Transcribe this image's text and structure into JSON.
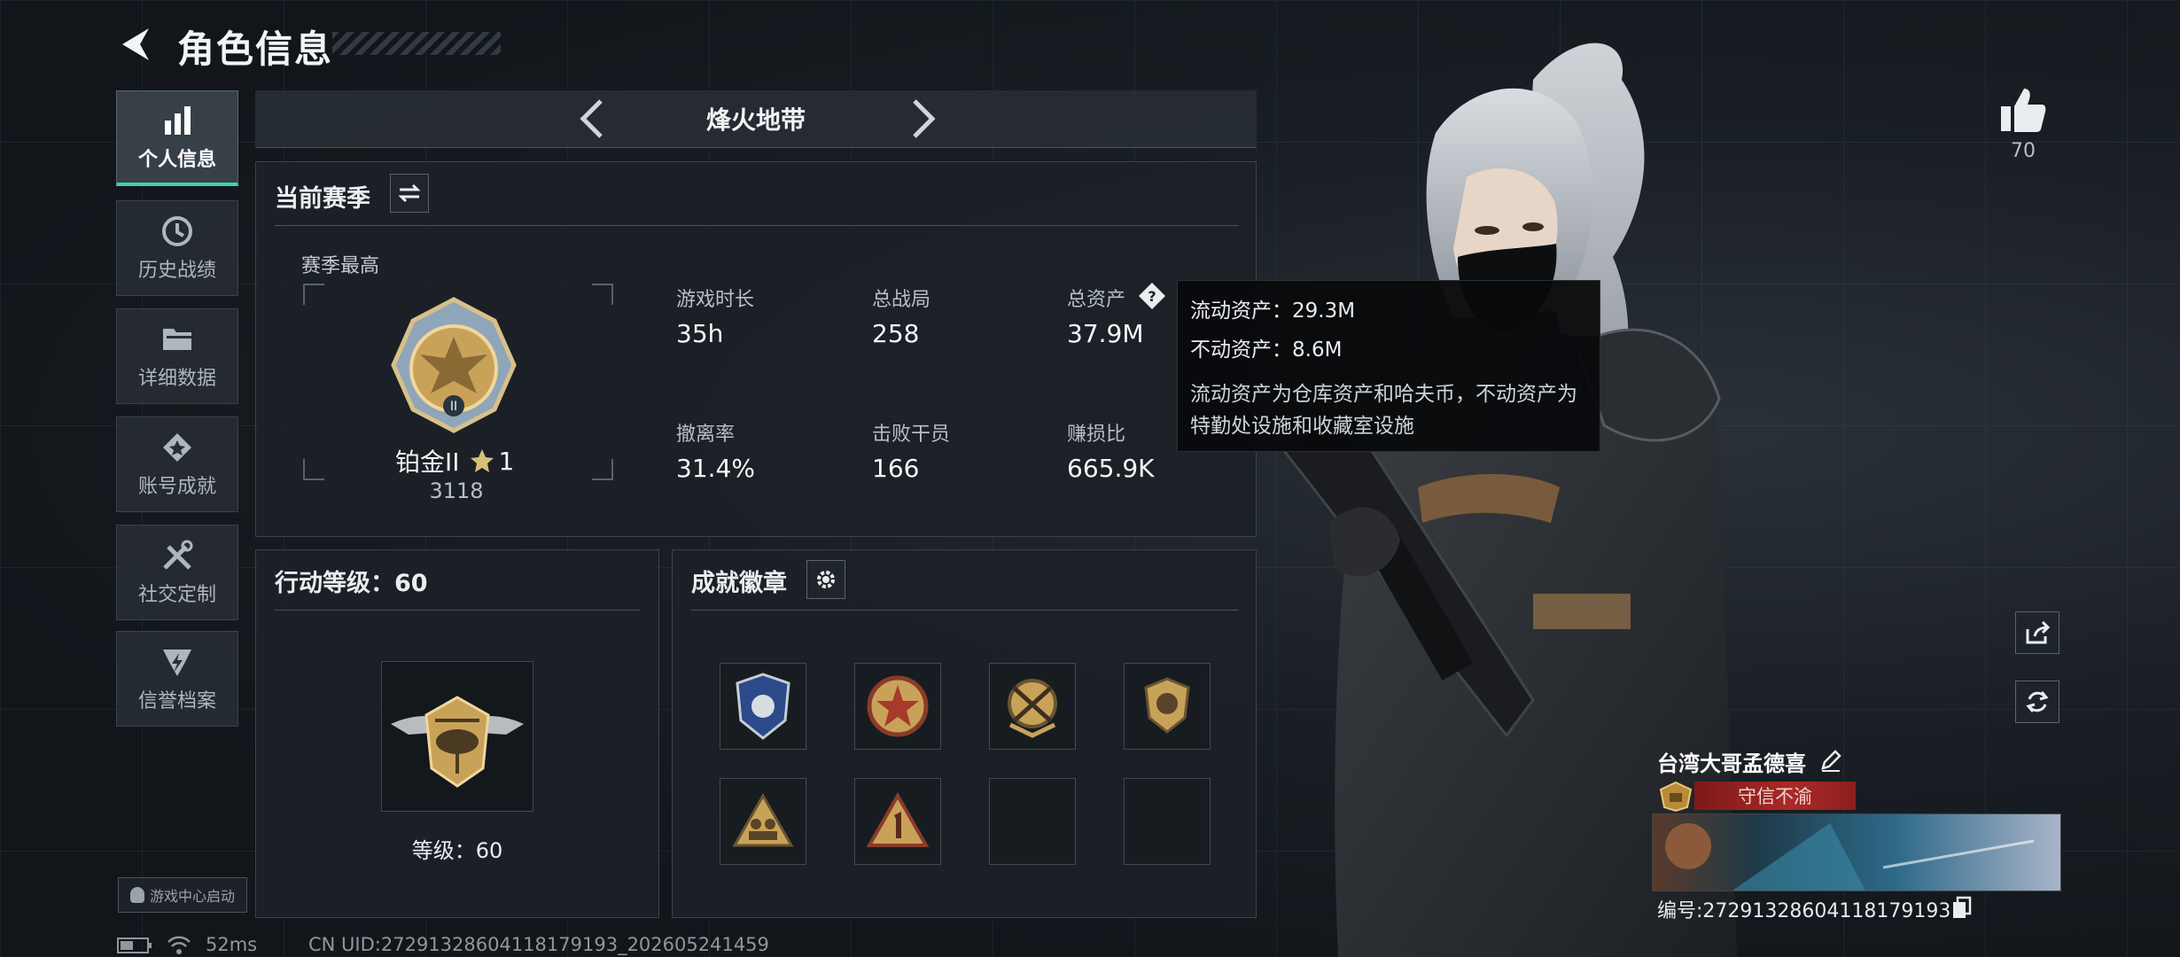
{
  "header": {
    "title": "角色信息"
  },
  "sidebar": {
    "items": [
      {
        "label": "个人信息",
        "icon": "bar-chart-icon",
        "active": true
      },
      {
        "label": "历史战绩",
        "icon": "history-icon"
      },
      {
        "label": "详细数据",
        "icon": "folder-icon"
      },
      {
        "label": "账号成就",
        "icon": "achievement-icon"
      },
      {
        "label": "社交定制",
        "icon": "tools-icon"
      },
      {
        "label": "信誉档案",
        "icon": "credit-icon"
      }
    ],
    "launch_label": "游戏中心启动"
  },
  "mode": {
    "title": "烽火地带"
  },
  "season": {
    "title": "当前赛季",
    "best_label": "赛季最高",
    "rank_name": "铂金II",
    "rank_stars": "1",
    "rank_score": "3118",
    "stats": [
      {
        "label": "游戏时长",
        "value": "35h"
      },
      {
        "label": "总战局",
        "value": "258"
      },
      {
        "label": "总资产",
        "value": "37.9M"
      },
      {
        "label": "撤离率",
        "value": "31.4%"
      },
      {
        "label": "击败干员",
        "value": "166"
      },
      {
        "label": "赚损比",
        "value": "665.9K"
      }
    ]
  },
  "tooltip": {
    "liquid": "流动资产：29.3M",
    "fixed": "不动资产：8.6M",
    "desc": "流动资产为仓库资产和哈夫币，不动资产为特勤处设施和收藏室设施"
  },
  "level": {
    "title": "行动等级：60",
    "label": "等级：60"
  },
  "badges": {
    "title": "成就徽章"
  },
  "likes": {
    "count": "70"
  },
  "player": {
    "name": "台湾大哥孟德喜",
    "title": "守信不渝",
    "id": "编号:27291328604118179193"
  },
  "footer": {
    "ping": "52ms",
    "uid": "CN UID:27291328604118179193_202605241459"
  },
  "colors": {
    "accent": "#3ed1b5",
    "title_red": "#a92a26",
    "gold": "#c9a25a"
  }
}
